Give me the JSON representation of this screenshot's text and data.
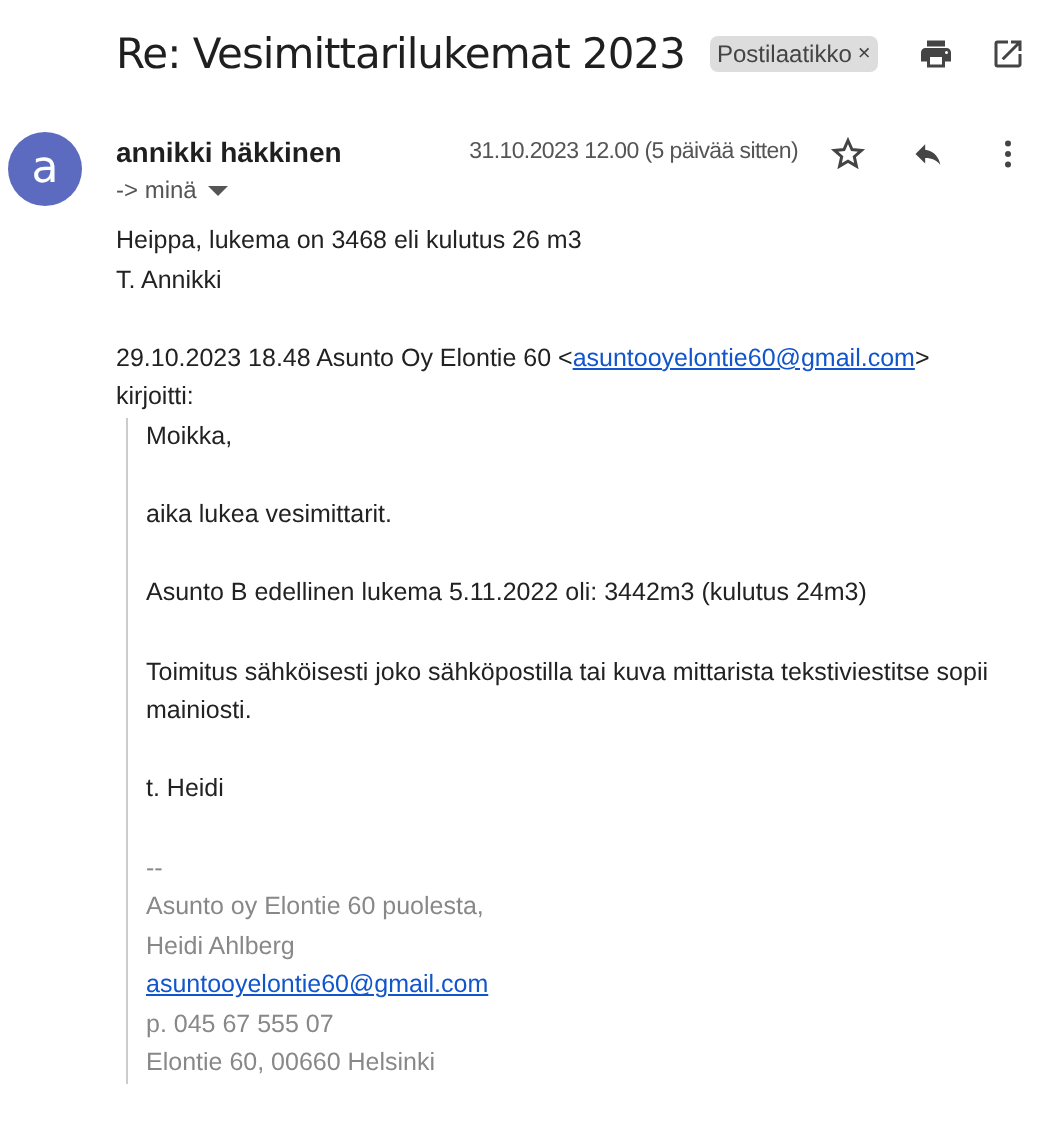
{
  "subject": "Re: Vesimittarilukemat 2023",
  "label": {
    "text": "Postilaatikko",
    "remove": "×"
  },
  "sender": {
    "avatar": "a",
    "name": "annikki häkkinen",
    "recipient": "-> minä",
    "date": "31.10.2023 12.00 (5 päivää sitten)",
    "starred": false
  },
  "body": [
    "Heippa, lukema on 3468 eli kulutus 26 m3",
    "T. Annikki"
  ],
  "quote_header": {
    "before": "29.10.2023 18.48 Asunto Oy Elontie 60 <",
    "link": "asuntooyelontie60@gmail.com",
    "after": ">",
    "tail": "kirjoitti:"
  },
  "quote": [
    "Moikka,",
    "aika lukea vesimittarit.",
    "Asunto B edellinen lukema 5.11.2022 oli: 3442m3 (kulutus 24m3)",
    "Toimitus sähköisesti joko sähköpostilla tai kuva mittarista tekstiviestitse sopii mainiosti.",
    "t. Heidi"
  ],
  "signature": [
    {
      "kind": "text",
      "text": "--"
    },
    {
      "kind": "text",
      "text": "Asunto oy Elontie 60 puolesta,"
    },
    {
      "kind": "text",
      "text": "Heidi Ahlberg"
    },
    {
      "kind": "link",
      "text": "asuntooyelontie60@gmail.com"
    },
    {
      "kind": "text",
      "text": "p. 045 67 555 07"
    },
    {
      "kind": "text",
      "text": "Elontie 60, 00660 Helsinki"
    }
  ]
}
